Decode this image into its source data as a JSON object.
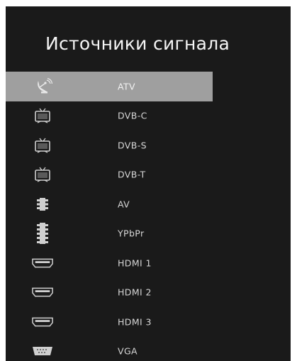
{
  "screen": {
    "title": "Источники сигнала"
  },
  "sources": [
    {
      "label": "ATV",
      "icon": "satellite-dish-icon",
      "selected": true
    },
    {
      "label": "DVB-C",
      "icon": "tv-icon",
      "selected": false
    },
    {
      "label": "DVB-S",
      "icon": "tv-icon",
      "selected": false
    },
    {
      "label": "DVB-T",
      "icon": "tv-icon",
      "selected": false
    },
    {
      "label": "AV",
      "icon": "av-connector-icon",
      "selected": false
    },
    {
      "label": "YPbPr",
      "icon": "ypbpr-connector-icon",
      "selected": false
    },
    {
      "label": "HDMI 1",
      "icon": "hdmi-port-icon",
      "selected": false
    },
    {
      "label": "HDMI 2",
      "icon": "hdmi-port-icon",
      "selected": false
    },
    {
      "label": "HDMI 3",
      "icon": "hdmi-port-icon",
      "selected": false
    },
    {
      "label": "VGA",
      "icon": "vga-port-icon",
      "selected": false
    }
  ],
  "colors": {
    "panel_background": "#1a1a1a",
    "selection_highlight": "#9f9f9f",
    "text": "#d7d7d7"
  }
}
